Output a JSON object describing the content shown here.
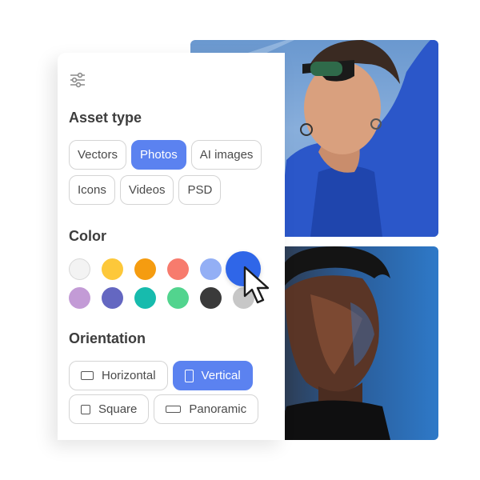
{
  "filter_panel": {
    "asset_type": {
      "title": "Asset type",
      "options": [
        {
          "label": "Vectors",
          "selected": false
        },
        {
          "label": "Photos",
          "selected": true
        },
        {
          "label": "AI images",
          "selected": false
        },
        {
          "label": "Icons",
          "selected": false
        },
        {
          "label": "Videos",
          "selected": false
        },
        {
          "label": "PSD",
          "selected": false
        }
      ]
    },
    "color": {
      "title": "Color",
      "swatches": [
        "#f3f3f3",
        "#fdc83a",
        "#f59c10",
        "#f77b6d",
        "#93aff5",
        "#2f66e8",
        "#c39bd6",
        "#6467c1",
        "#17bbad",
        "#52d48e",
        "#3a3a3a",
        "#c7c7c7"
      ],
      "selected": "#2f66e8"
    },
    "orientation": {
      "title": "Orientation",
      "options": [
        {
          "label": "Horizontal",
          "selected": false,
          "icon": "horizontal-rect-icon"
        },
        {
          "label": "Vertical",
          "selected": true,
          "icon": "vertical-rect-icon"
        },
        {
          "label": "Square",
          "selected": false,
          "icon": "square-icon"
        },
        {
          "label": "Panoramic",
          "selected": false,
          "icon": "panoramic-rect-icon"
        }
      ]
    }
  },
  "colors": {
    "accent": "#5b82f0",
    "chip_border": "#d4d4d4"
  }
}
